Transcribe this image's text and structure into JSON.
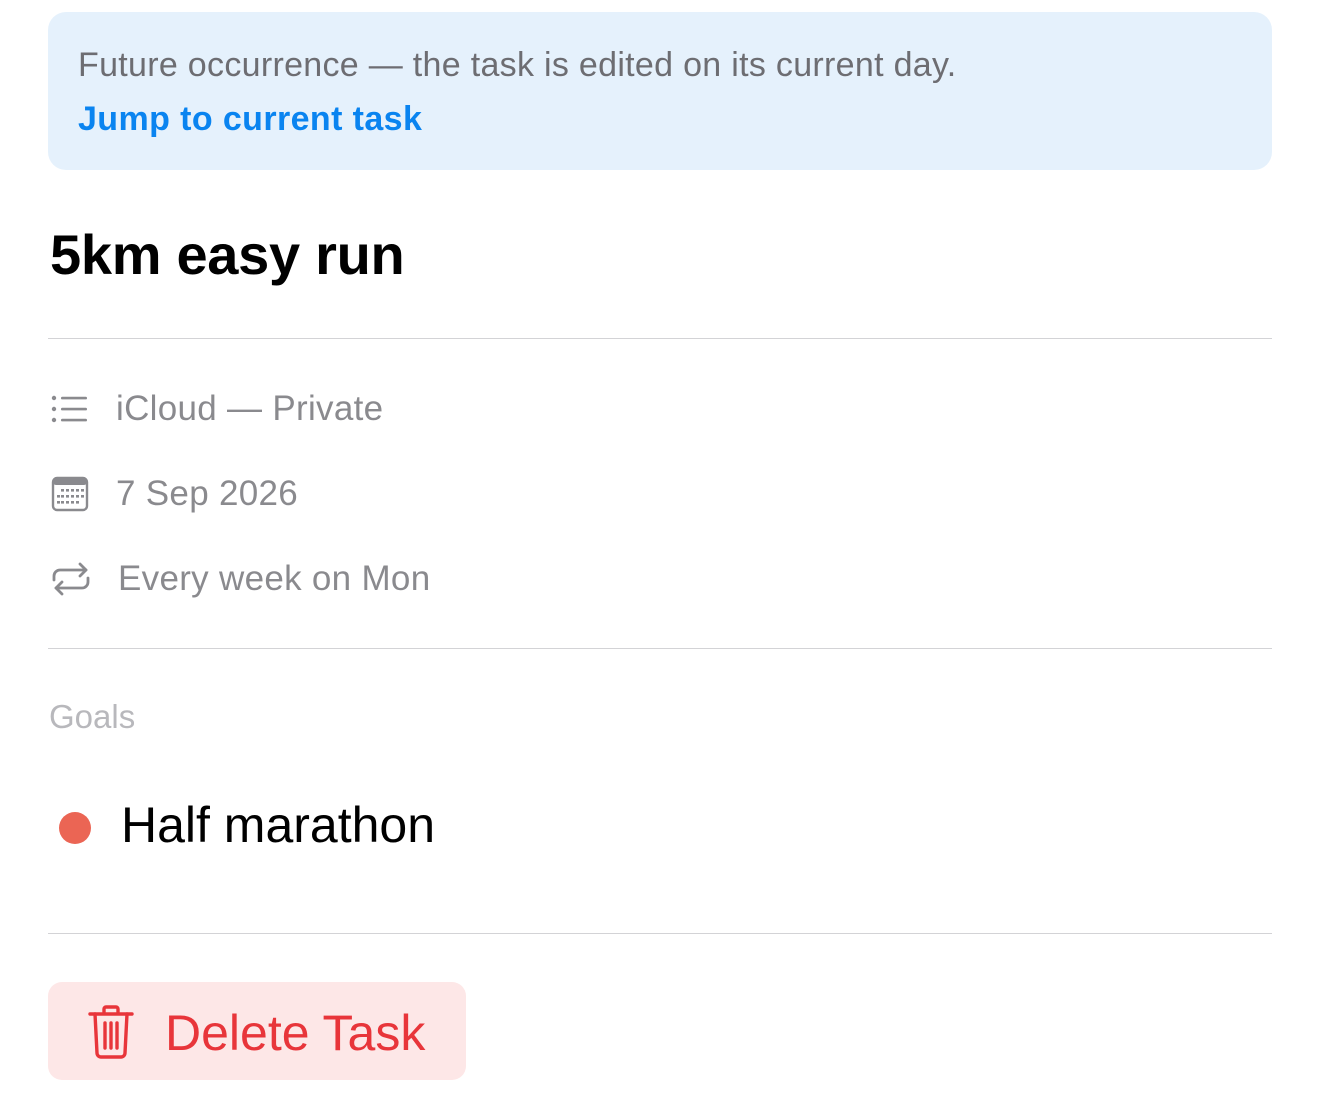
{
  "banner": {
    "message": "Future occurrence — the task is edited on its current day.",
    "link_label": "Jump to current task"
  },
  "task": {
    "title": "5km easy run"
  },
  "details": {
    "list": {
      "icon": "list-icon",
      "label": "iCloud — Private"
    },
    "date": {
      "icon": "calendar-icon",
      "label": "7 Sep 2026"
    },
    "repeat": {
      "icon": "repeat-icon",
      "label": "Every week on Mon"
    }
  },
  "goals": {
    "header": "Goals",
    "items": [
      {
        "label": "Half marathon",
        "color": "#eb6554"
      }
    ]
  },
  "actions": {
    "delete_label": "Delete Task",
    "delete_icon": "trash-icon"
  },
  "colors": {
    "accent": "#0a84f0",
    "banner_bg": "#e5f1fc",
    "destructive": "#e8353a",
    "destructive_bg": "#fde7e7"
  }
}
